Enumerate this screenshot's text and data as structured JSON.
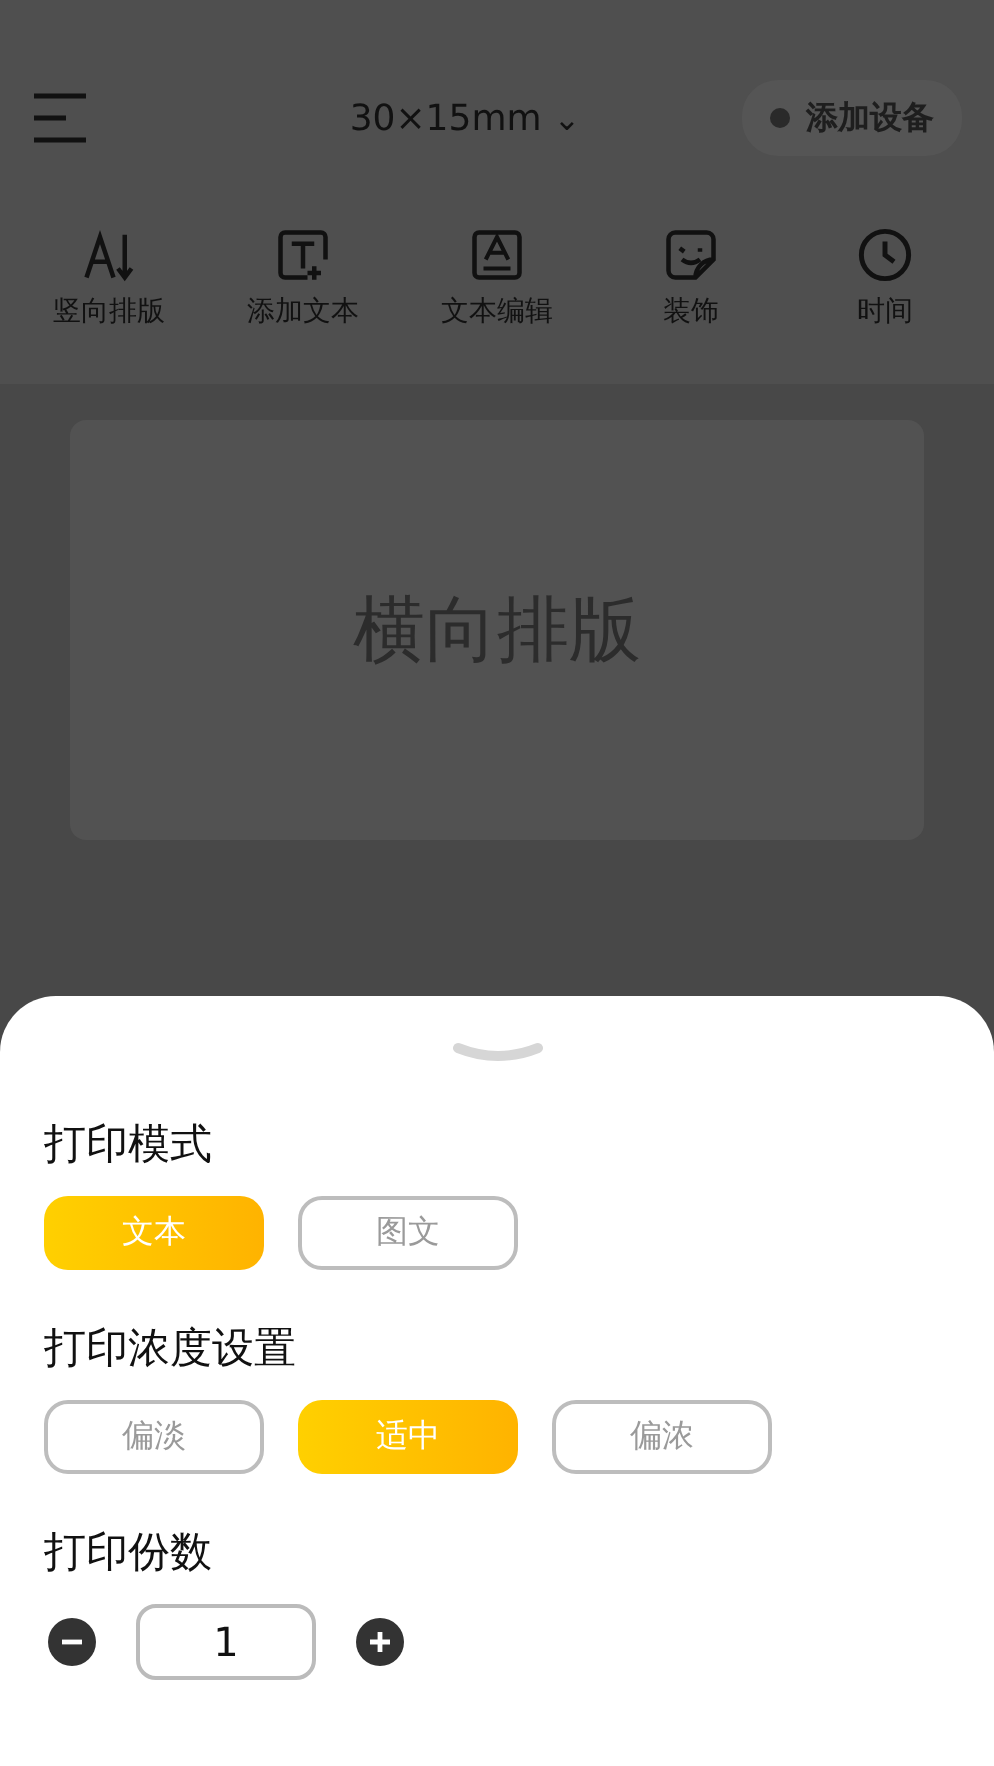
{
  "header": {
    "size": "30×15mm",
    "chevron": "⌄",
    "device_button": "添加设备"
  },
  "tools": [
    {
      "kind": "vertical",
      "label": "竖向排版"
    },
    {
      "kind": "addtext",
      "label": "添加文本"
    },
    {
      "kind": "edittext",
      "label": "文本编辑"
    },
    {
      "kind": "sticker",
      "label": "装饰"
    },
    {
      "kind": "clock",
      "label": "时间"
    }
  ],
  "label_preview": {
    "text": "横向排版"
  },
  "sheet": {
    "sections": [
      {
        "title": "打印模式",
        "options": [
          {
            "label": "文本",
            "selected": true
          },
          {
            "label": "图文",
            "selected": false
          }
        ]
      },
      {
        "title": "打印浓度设置",
        "options": [
          {
            "label": "偏淡",
            "selected": false
          },
          {
            "label": "适中",
            "selected": true
          },
          {
            "label": "偏浓",
            "selected": false
          }
        ]
      }
    ],
    "copies": {
      "title": "打印份数",
      "value": "1"
    }
  }
}
